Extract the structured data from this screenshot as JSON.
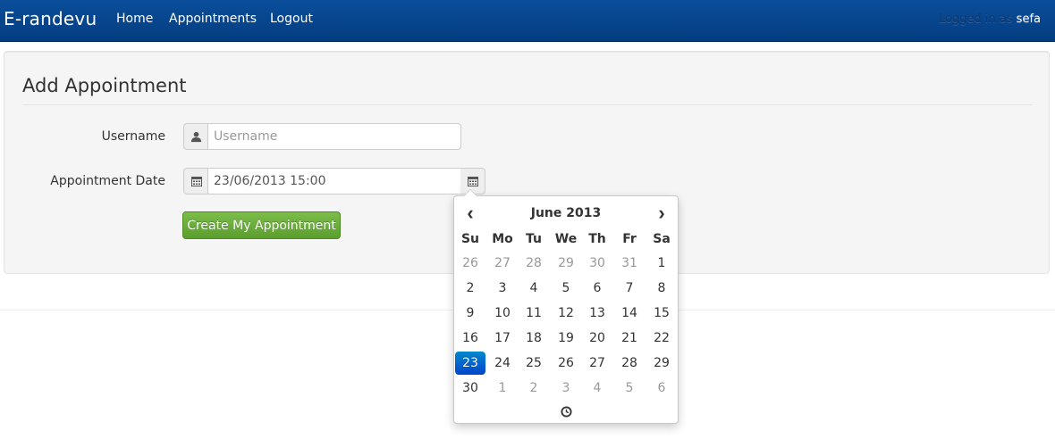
{
  "navbar": {
    "brand": "E-randevu",
    "links": [
      "Home",
      "Appointments",
      "Logout"
    ],
    "logged_in_prefix": "Logged in as",
    "username": "sefa"
  },
  "form": {
    "legend": "Add Appointment",
    "username_label": "Username",
    "username_placeholder": "Username",
    "username_icon": "user-icon",
    "date_label": "Appointment Date",
    "date_value": "23/06/2013 15:00",
    "date_icon": "calendar-icon",
    "submit_label": "Create My Appointment"
  },
  "datepicker": {
    "prev": "‹",
    "next": "›",
    "month_label": "June 2013",
    "weekdays": [
      "Su",
      "Mo",
      "Tu",
      "We",
      "Th",
      "Fr",
      "Sa"
    ],
    "weeks": [
      [
        "26",
        "27",
        "28",
        "29",
        "30",
        "31",
        "1"
      ],
      [
        "2",
        "3",
        "4",
        "5",
        "6",
        "7",
        "8"
      ],
      [
        "9",
        "10",
        "11",
        "12",
        "13",
        "14",
        "15"
      ],
      [
        "16",
        "17",
        "18",
        "19",
        "20",
        "21",
        "22"
      ],
      [
        "23",
        "24",
        "25",
        "26",
        "27",
        "28",
        "29"
      ],
      [
        "30",
        "1",
        "2",
        "3",
        "4",
        "5",
        "6"
      ]
    ],
    "muted": [
      [
        true,
        true,
        true,
        true,
        true,
        true,
        false
      ],
      [
        false,
        false,
        false,
        false,
        false,
        false,
        false
      ],
      [
        false,
        false,
        false,
        false,
        false,
        false,
        false
      ],
      [
        false,
        false,
        false,
        false,
        false,
        false,
        false
      ],
      [
        false,
        false,
        false,
        false,
        false,
        false,
        false
      ],
      [
        false,
        true,
        true,
        true,
        true,
        true,
        true
      ]
    ],
    "selected_day": "23",
    "time_icon": "clock-icon"
  },
  "colors": {
    "navbar": "#0a4e9b",
    "accent_green": "#62a834",
    "selected_blue": "#0066cc"
  }
}
